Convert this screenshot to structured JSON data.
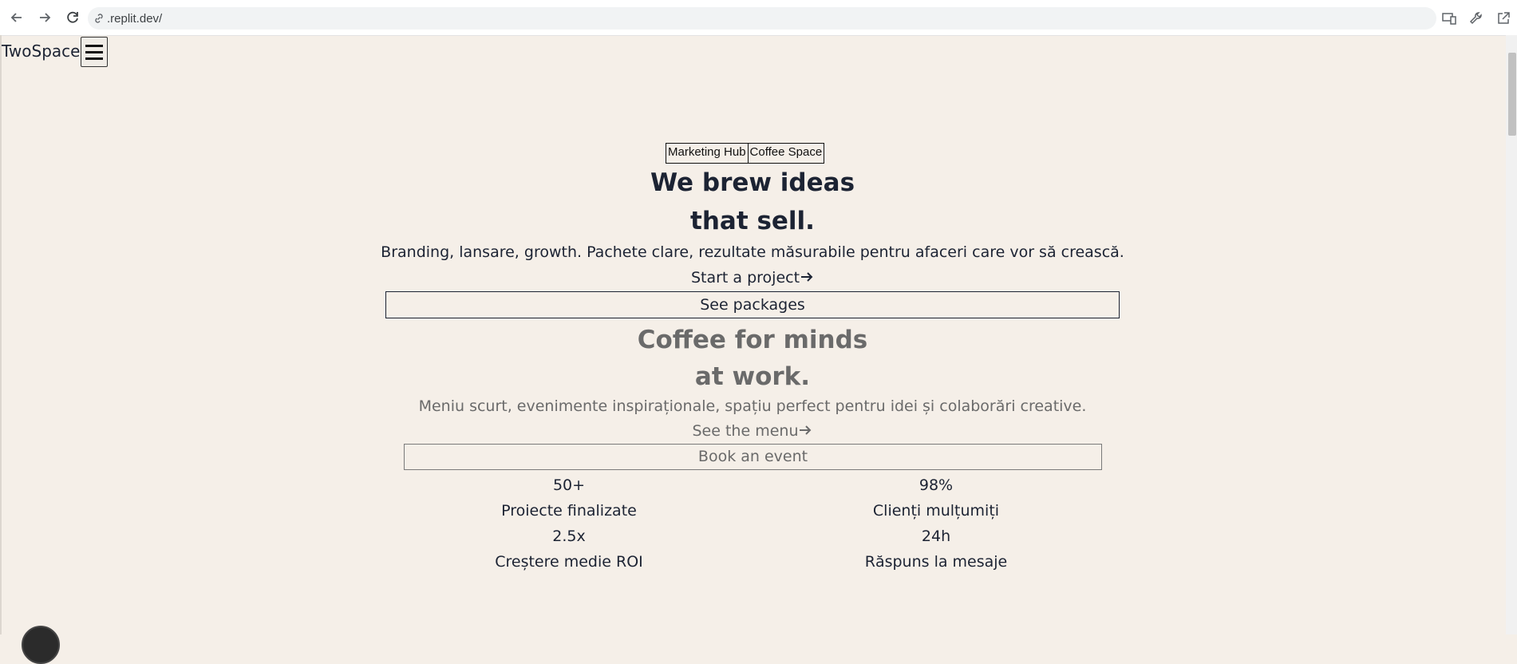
{
  "browser": {
    "url": ".replit.dev/",
    "icons": [
      "back-arrow-icon",
      "forward-arrow-icon",
      "reload-icon",
      "link-icon",
      "devices-icon",
      "wrench-icon",
      "open-external-icon"
    ]
  },
  "header": {
    "brand": "TwoSpace",
    "menu_icon": "hamburger-icon"
  },
  "toggle": {
    "options": [
      "Marketing Hub",
      "Coffee Space"
    ]
  },
  "marketing": {
    "title_line1": "We brew ideas",
    "title_line2": "that sell.",
    "subtitle": "Branding, lansare, growth. Pachete clare, rezultate măsurabile pentru afaceri care vor să crească.",
    "cta_primary": "Start a project",
    "cta_secondary": "See packages"
  },
  "coffee": {
    "title_line1": "Coffee for minds",
    "title_line2": "at work.",
    "subtitle": "Meniu scurt, evenimente inspiraționale, spațiu perfect pentru idei și colaborări creative.",
    "cta_primary": "See the menu",
    "cta_secondary": "Book an event"
  },
  "stats": [
    {
      "value": "50+",
      "label": "Proiecte finalizate"
    },
    {
      "value": "98%",
      "label": "Clienți mulțumiți"
    },
    {
      "value": "2.5x",
      "label": "Creștere medie ROI"
    },
    {
      "value": "24h",
      "label": "Răspuns la mesaje"
    }
  ],
  "colors": {
    "background": "#f5efe8",
    "text": "#1c2333",
    "muted_text": "#6a6a6a"
  }
}
